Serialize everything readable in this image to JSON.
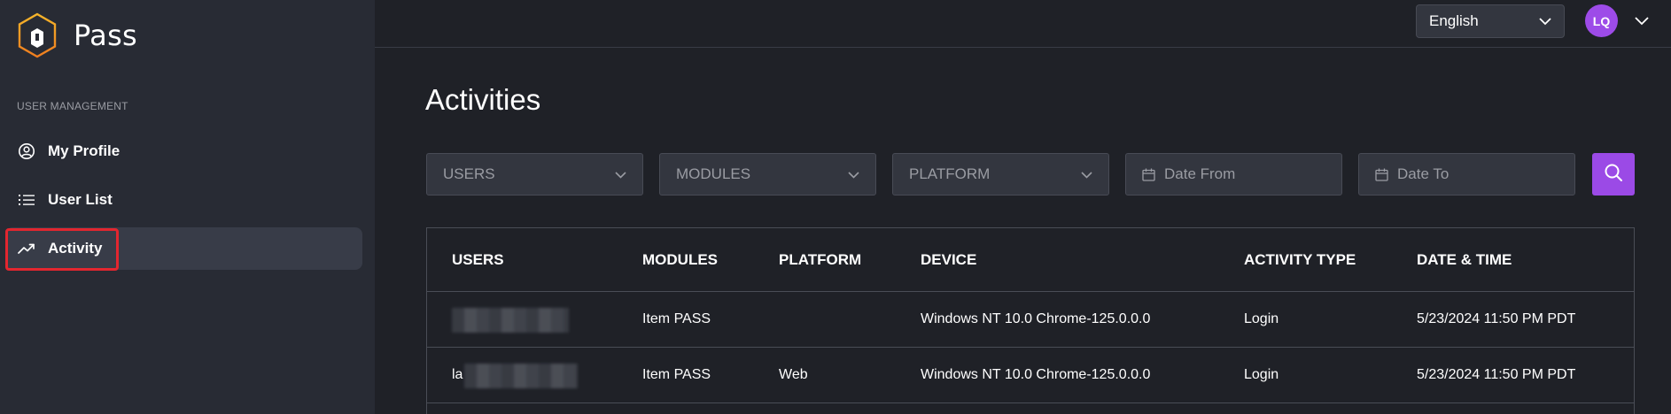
{
  "brand": {
    "name": "Pass"
  },
  "sidebar": {
    "section_label": "USER MANAGEMENT",
    "items": [
      {
        "label": "My Profile",
        "icon": "user-circle-icon"
      },
      {
        "label": "User List",
        "icon": "list-icon"
      },
      {
        "label": "Activity",
        "icon": "trending-up-icon",
        "active": true
      }
    ]
  },
  "topbar": {
    "language": "English",
    "avatar_initials": "LQ"
  },
  "page": {
    "title": "Activities"
  },
  "filters": {
    "users_placeholder": "USERS",
    "modules_placeholder": "MODULES",
    "platform_placeholder": "PLATFORM",
    "date_from_placeholder": "Date From",
    "date_to_placeholder": "Date To"
  },
  "table": {
    "headers": [
      "USERS",
      "MODULES",
      "PLATFORM",
      "DEVICE",
      "ACTIVITY TYPE",
      "DATE & TIME"
    ],
    "rows": [
      {
        "user": "",
        "module": "Item PASS",
        "platform": "",
        "device": "Windows NT 10.0 Chrome-125.0.0.0",
        "activity_type": "Login",
        "datetime": "5/23/2024 11:50 PM PDT"
      },
      {
        "user": "la",
        "module": "Item PASS",
        "platform": "Web",
        "device": "Windows NT 10.0 Chrome-125.0.0.0",
        "activity_type": "Login",
        "datetime": "5/23/2024 11:50 PM PDT"
      }
    ]
  },
  "colors": {
    "accent": "#9b4ae6",
    "sidebar_bg": "#282b34",
    "page_bg": "#1f2127",
    "highlight": "#e3262f"
  }
}
